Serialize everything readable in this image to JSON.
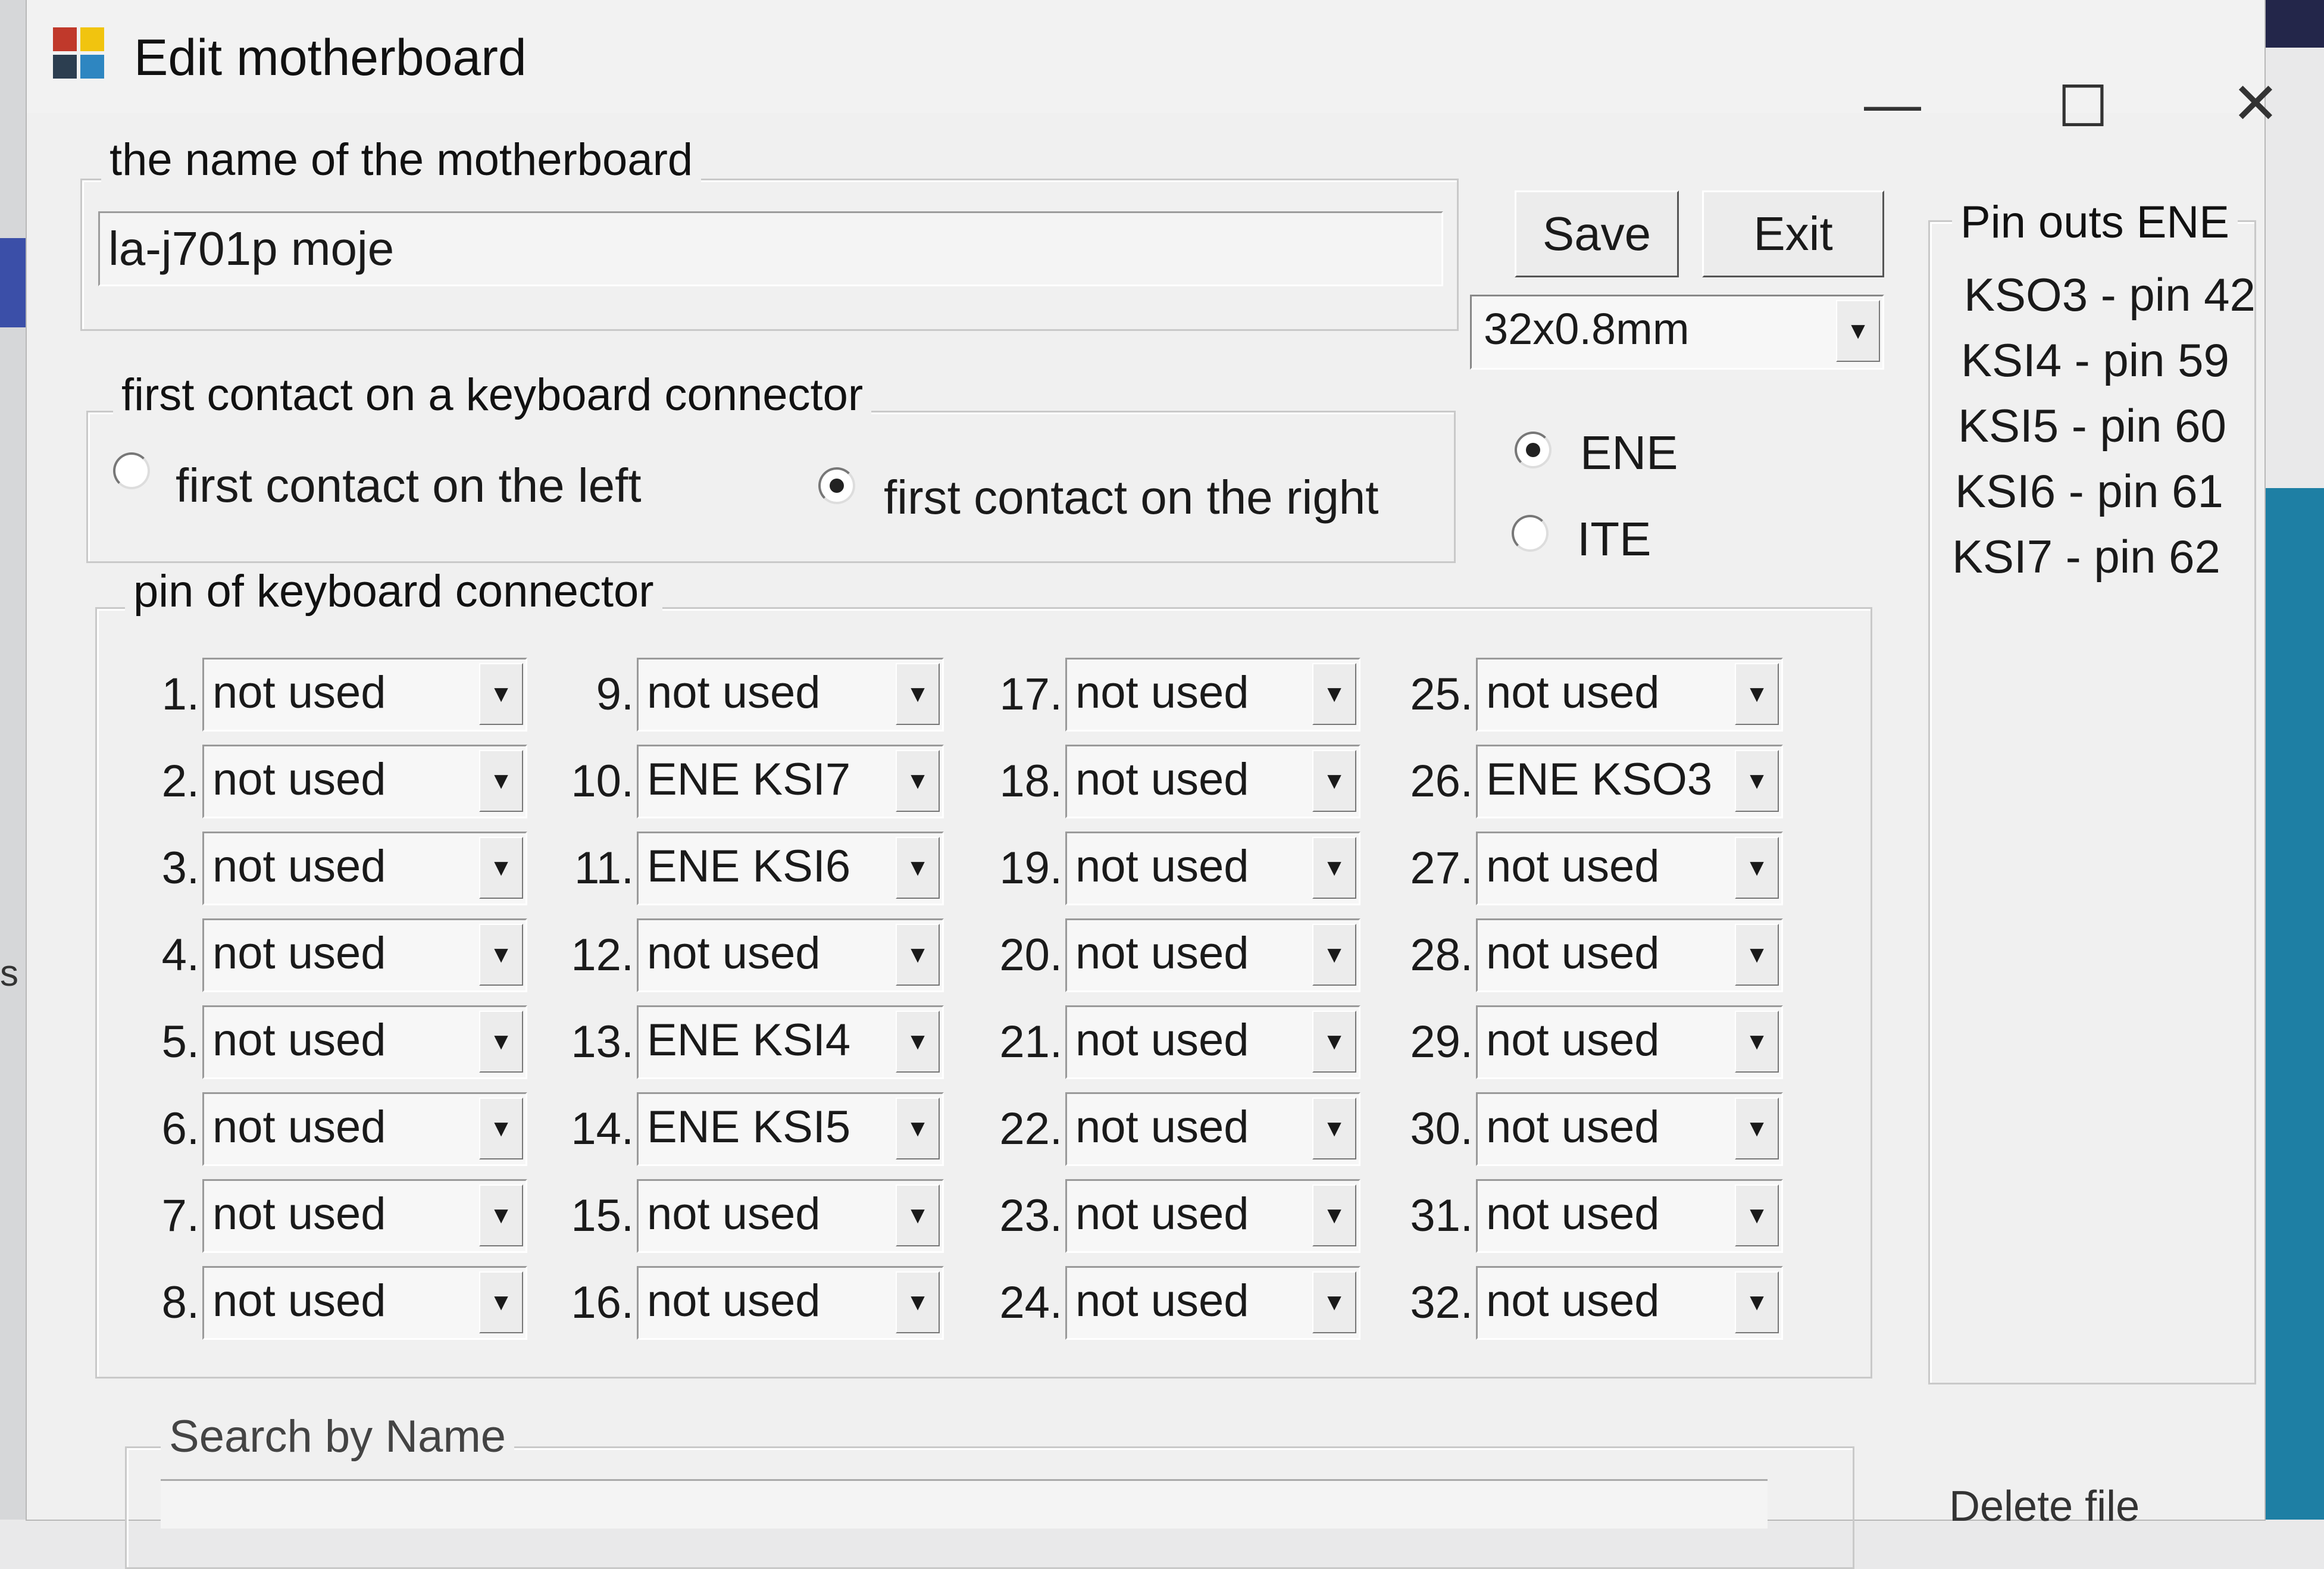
{
  "window": {
    "title": "Edit motherboard",
    "minimize_glyph": "—",
    "maximize_glyph": "☐",
    "close_glyph": "✕"
  },
  "name_group": {
    "legend": "the name of the motherboard",
    "value": "la-j701p moje"
  },
  "buttons": {
    "save": "Save",
    "exit": "Exit",
    "delete_file": "Delete file"
  },
  "connector_size": {
    "selected": "32x0.8mm"
  },
  "contact_group": {
    "legend": "first contact on a keyboard connector",
    "options": [
      {
        "label": "first contact on the left",
        "checked": false
      },
      {
        "label": "first contact on the right",
        "checked": true
      }
    ]
  },
  "ec_type": {
    "options": [
      {
        "label": "ENE",
        "checked": true
      },
      {
        "label": "ITE",
        "checked": false
      }
    ]
  },
  "pins_group": {
    "legend": "pin of keyboard connector",
    "pins": [
      {
        "num": "1.",
        "value": "not used"
      },
      {
        "num": "2.",
        "value": "not used"
      },
      {
        "num": "3.",
        "value": "not used"
      },
      {
        "num": "4.",
        "value": "not used"
      },
      {
        "num": "5.",
        "value": "not used"
      },
      {
        "num": "6.",
        "value": "not used"
      },
      {
        "num": "7.",
        "value": "not used"
      },
      {
        "num": "8.",
        "value": "not used"
      },
      {
        "num": "9.",
        "value": "not used"
      },
      {
        "num": "10.",
        "value": "ENE KSI7"
      },
      {
        "num": "11.",
        "value": "ENE KSI6"
      },
      {
        "num": "12.",
        "value": "not used"
      },
      {
        "num": "13.",
        "value": "ENE KSI4"
      },
      {
        "num": "14.",
        "value": "ENE KSI5"
      },
      {
        "num": "15.",
        "value": "not used"
      },
      {
        "num": "16.",
        "value": "not used"
      },
      {
        "num": "17.",
        "value": "not used"
      },
      {
        "num": "18.",
        "value": "not used"
      },
      {
        "num": "19.",
        "value": "not used"
      },
      {
        "num": "20.",
        "value": "not used"
      },
      {
        "num": "21.",
        "value": "not used"
      },
      {
        "num": "22.",
        "value": "not used"
      },
      {
        "num": "23.",
        "value": "not used"
      },
      {
        "num": "24.",
        "value": "not used"
      },
      {
        "num": "25.",
        "value": "not used"
      },
      {
        "num": "26.",
        "value": "ENE KSO3"
      },
      {
        "num": "27.",
        "value": "not used"
      },
      {
        "num": "28.",
        "value": "not used"
      },
      {
        "num": "29.",
        "value": "not used"
      },
      {
        "num": "30.",
        "value": "not used"
      },
      {
        "num": "31.",
        "value": "not used"
      },
      {
        "num": "32.",
        "value": "not used"
      }
    ]
  },
  "pinouts": {
    "legend": "Pin outs ENE",
    "lines": [
      "KSO3 - pin 42",
      "KSI4  - pin 59",
      "KSI5  - pin 60",
      "KSI6  - pin 61",
      "KSI7  - pin 62"
    ]
  },
  "search": {
    "legend": "Search by Name"
  },
  "background": {
    "cut_text": "s co"
  },
  "icons": {
    "dropdown": "chevron-down-icon",
    "app": "app-window-icon"
  },
  "colors": {
    "window_bg": "#f0f0f0",
    "desktop_teal": "#1e7fa4",
    "desktop_blue": "#2459a8"
  }
}
